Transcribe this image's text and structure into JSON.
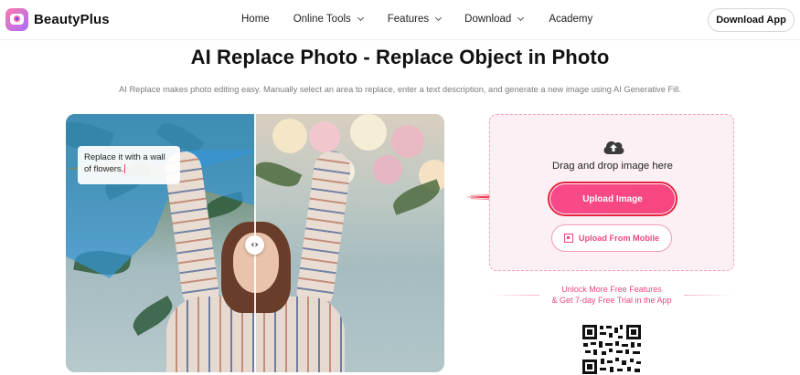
{
  "brand": {
    "name": "BeautyPlus"
  },
  "nav": {
    "items": [
      {
        "label": "Home",
        "has_dropdown": false
      },
      {
        "label": "Online Tools",
        "has_dropdown": true
      },
      {
        "label": "Features",
        "has_dropdown": true
      },
      {
        "label": "Download",
        "has_dropdown": true
      },
      {
        "label": "Academy",
        "has_dropdown": false
      }
    ],
    "cta_label": "Download App"
  },
  "hero": {
    "title": "AI Replace Photo - Replace Object in Photo",
    "subtitle": "AI Replace makes photo editing easy. Manually select an area to replace, enter a text description, and generate a new image using AI Generative Fill."
  },
  "demo": {
    "prompt_text": "Replace it with a wall of flowers."
  },
  "upload": {
    "drag_text": "Drag and drop image here",
    "upload_button": "Upload Image",
    "mobile_button": "Upload From Mobile"
  },
  "promo": {
    "line1": "Unlock More Free Features",
    "line2": "& Get 7-day Free Trial in the App"
  },
  "colors": {
    "accent": "#f7467f",
    "highlight_ring": "#e8203d",
    "mask": "#3496d7",
    "upload_bg": "#fdf0f5"
  }
}
